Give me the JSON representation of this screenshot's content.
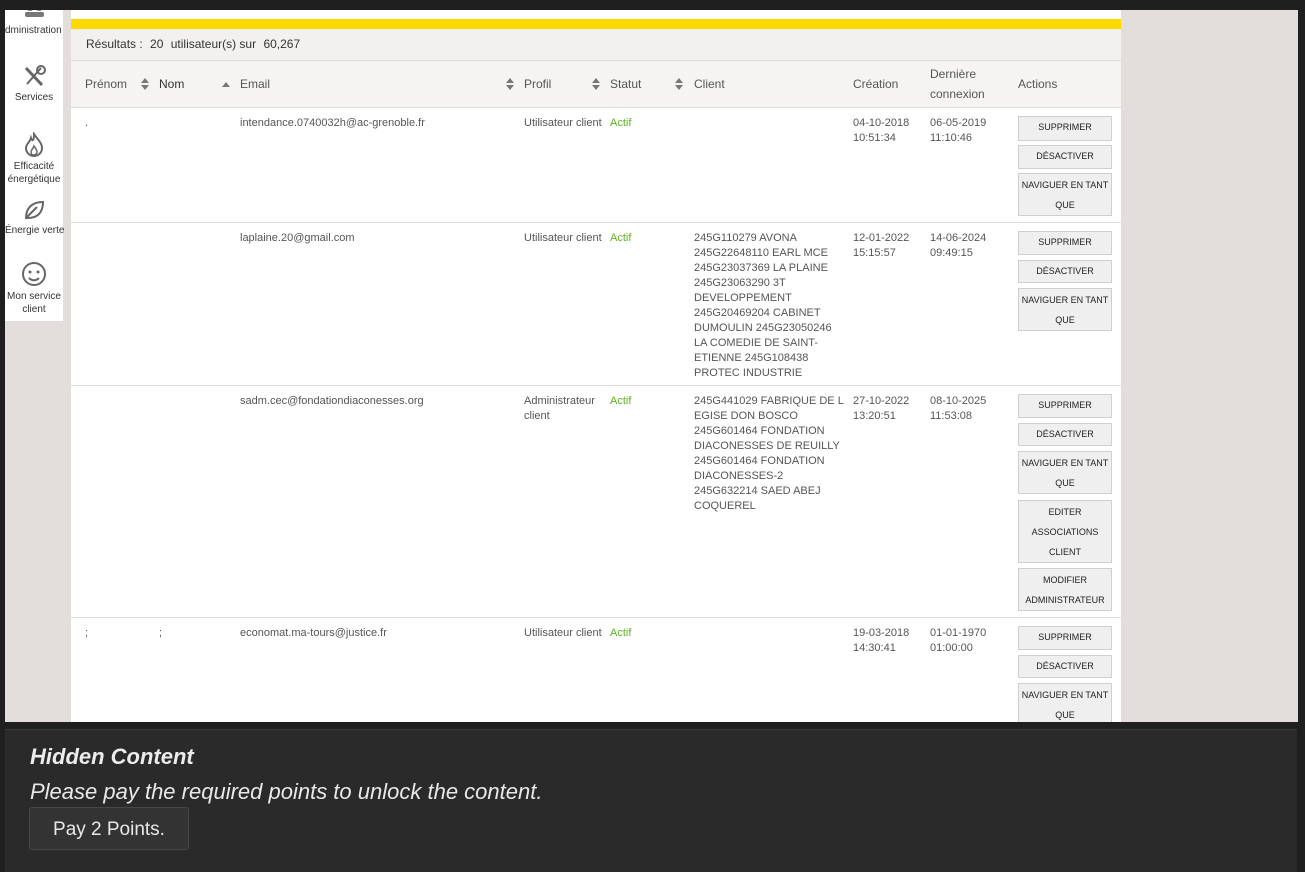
{
  "sidebar": {
    "items": [
      {
        "label": "Administration",
        "icon": "users-icon"
      },
      {
        "label": "Services",
        "icon": "tools-icon"
      },
      {
        "label": "Efficacité énergétique",
        "icon": "flame-icon"
      },
      {
        "label": "Énergie verte",
        "icon": "leaf-icon"
      },
      {
        "label": "Mon service client",
        "icon": "headset-icon"
      }
    ]
  },
  "results": {
    "prefix": "Résultats :",
    "count": "20",
    "middle": "utilisateur(s) sur",
    "total": "60,267"
  },
  "table": {
    "headers": {
      "prenom": "Prénom",
      "nom": "Nom",
      "email": "Email",
      "profil": "Profil",
      "statut": "Statut",
      "client": "Client",
      "creation": "Création",
      "derniere_line1": "Dernière",
      "derniere_line2": "connexion",
      "actions": "Actions"
    },
    "rows": [
      {
        "prenom": ".",
        "nom": "",
        "email": "intendance.0740032h@ac-grenoble.fr",
        "profil": "Utilisateur client",
        "statut": "Actif",
        "client": [],
        "creation_date": "04-10-2018",
        "creation_time": "10:51:34",
        "last_date": "06-05-2019",
        "last_time": "11:10:46",
        "actions": [
          "SUPPRIMER",
          "DÉSACTIVER",
          "NAVIGUER EN TANT QUE"
        ]
      },
      {
        "prenom": "",
        "nom": "",
        "email": "laplaine.20@gmail.com",
        "profil": "Utilisateur client",
        "statut": "Actif",
        "client": [
          "245G110279 AVONA",
          "245G22648110 EARL MCE",
          "245G23037369 LA PLAINE",
          "245G23063290 3T",
          "DEVELOPPEMENT",
          "245G20469204 CABINET",
          "DUMOULIN 245G23050246",
          "LA COMEDIE DE SAINT-",
          "ETIENNE 245G108438",
          "PROTEC INDUSTRIE"
        ],
        "creation_date": "12-01-2022",
        "creation_time": "15:15:57",
        "last_date": "14-06-2024",
        "last_time": "09:49:15",
        "actions": [
          "SUPPRIMER",
          "DÉSACTIVER",
          "NAVIGUER EN TANT QUE"
        ]
      },
      {
        "prenom": "",
        "nom": "",
        "email": "sadm.cec@fondationdiaconesses.org",
        "profil": "Administrateur client",
        "statut": "Actif",
        "client": [
          "245G441029 FABRIQUE DE L",
          "EGISE DON BOSCO",
          "245G601464 FONDATION",
          "DIACONESSES DE REUILLY",
          "245G601464 FONDATION",
          "DIACONESSES-2",
          "245G632214 SAED ABEJ",
          "COQUEREL"
        ],
        "creation_date": "27-10-2022",
        "creation_time": "13:20:51",
        "last_date": "08-10-2025",
        "last_time": "11:53:08",
        "actions": [
          "SUPPRIMER",
          "DÉSACTIVER",
          "NAVIGUER EN TANT QUE",
          "EDITER ASSOCIATIONS CLIENT",
          "MODIFIER ADMINISTRATEUR"
        ]
      },
      {
        "prenom": ";",
        "nom": ";",
        "email": "economat.ma-tours@justice.fr",
        "profil": "Utilisateur client",
        "statut": "Actif",
        "client": [],
        "creation_date": "19-03-2018",
        "creation_time": "14:30:41",
        "last_date": "01-01-1970",
        "last_time": "01:00:00",
        "actions": [
          "SUPPRIMER",
          "DÉSACTIVER",
          "NAVIGUER EN TANT QUE"
        ]
      }
    ]
  },
  "hidden_content": {
    "title": "Hidden Content",
    "message": "Please pay the required points to unlock the content.",
    "button": "Pay 2 Points."
  }
}
